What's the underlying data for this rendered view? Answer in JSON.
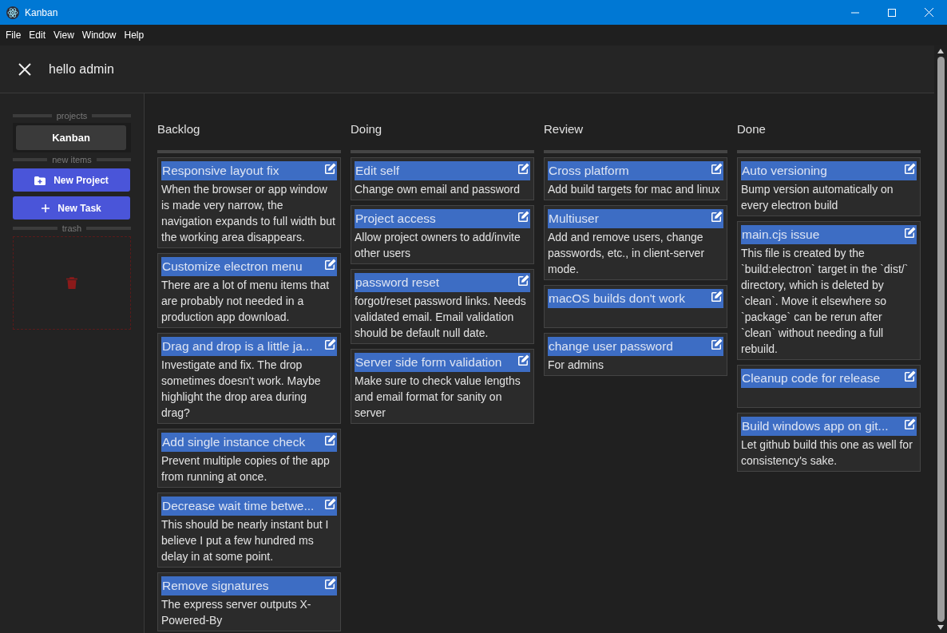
{
  "window": {
    "title": "Kanban"
  },
  "menu": [
    "File",
    "Edit",
    "View",
    "Window",
    "Help"
  ],
  "header": {
    "greeting": "hello admin"
  },
  "sidebar": {
    "projects_label": "projects",
    "projects": [
      {
        "name": "Kanban",
        "selected": true
      }
    ],
    "new_items_label": "new items",
    "buttons": [
      {
        "label": "New Project",
        "kind": "project"
      },
      {
        "label": "New Task",
        "kind": "task"
      }
    ],
    "trash_label": "trash"
  },
  "columns": [
    {
      "title": "Backlog",
      "cards": [
        {
          "title": "Responsive layout fix",
          "description": "When the browser or app window is made very narrow, the navigation expands to full width but the working area disappears."
        },
        {
          "title": "Customize electron menu",
          "description": "There are a lot of menu items that are probably not needed in a production app download."
        },
        {
          "title": "Drag and drop is a little ja...",
          "description": "Investigate and fix. The drop sometimes doesn't work. Maybe highlight the drop area during drag?"
        },
        {
          "title": "Add single instance check",
          "description": "Prevent multiple copies of the app from running at once."
        },
        {
          "title": "Decrease wait time betwe...",
          "description": "This should be nearly instant but I believe I put a few hundred ms delay in at some point."
        },
        {
          "title": "Remove signatures",
          "description": "The express server outputs X-Powered-By"
        }
      ]
    },
    {
      "title": "Doing",
      "cards": [
        {
          "title": "Edit self",
          "description": "Change own email and password"
        },
        {
          "title": "Project access",
          "description": "Allow project owners to add/invite other users"
        },
        {
          "title": "password reset",
          "description": "forgot/reset password links. Needs validated email. Email validation should be default null date."
        },
        {
          "title": "Server side form validation",
          "description": "Make sure to check value lengths and email format for sanity on server"
        }
      ]
    },
    {
      "title": "Review",
      "cards": [
        {
          "title": "Cross platform",
          "description": "Add build targets for mac and linux"
        },
        {
          "title": "Multiuser",
          "description": "Add and remove users, change passwords, etc., in client-server mode."
        },
        {
          "title": "macOS builds don't work"
        },
        {
          "title": "change user password",
          "description": "For admins"
        }
      ]
    },
    {
      "title": "Done",
      "cards": [
        {
          "title": "Auto versioning",
          "description": "Bump version automatically on every electron build"
        },
        {
          "title": "main.cjs issue",
          "description": "This file is created by the `build:electron` target in the `dist/` directory, which is deleted by `clean`. Move it elsewhere so `package` can be rerun after `clean` without needing a full rebuild."
        },
        {
          "title": "Cleanup code for release"
        },
        {
          "title": "Build windows app on git...",
          "description": "Let github build this one as well for consistency's sake."
        }
      ]
    }
  ]
}
